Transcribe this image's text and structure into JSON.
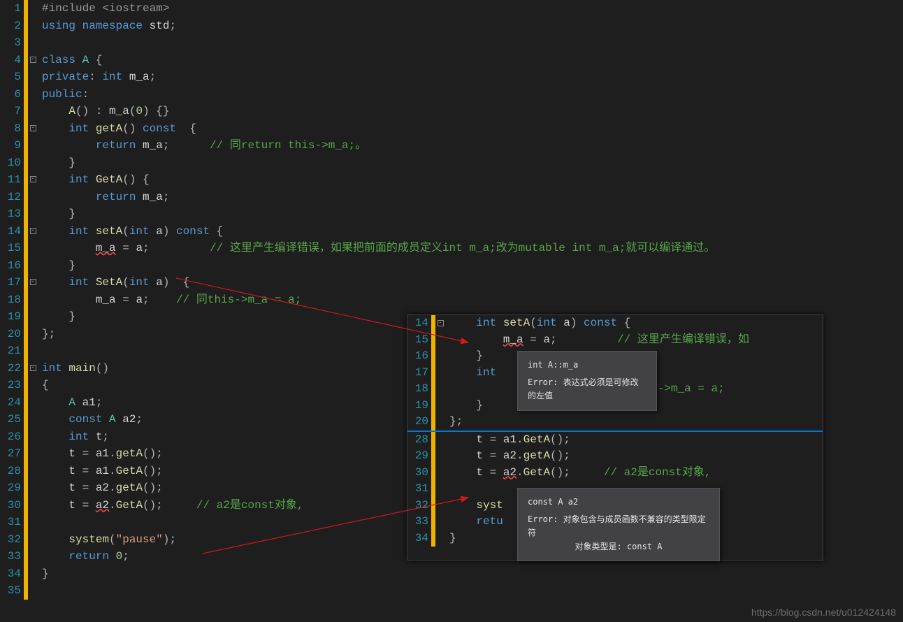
{
  "main": {
    "lines": [
      {
        "n": 1,
        "fold": "",
        "code": [
          {
            "c": "pp",
            "t": "#include <iostream>"
          }
        ]
      },
      {
        "n": 2,
        "fold": "",
        "code": [
          {
            "c": "kw",
            "t": "using namespace "
          },
          {
            "c": "id",
            "t": "std"
          },
          {
            "c": "op",
            "t": ";"
          }
        ]
      },
      {
        "n": 3,
        "fold": "",
        "code": []
      },
      {
        "n": 4,
        "fold": "-",
        "code": [
          {
            "c": "kw",
            "t": "class "
          },
          {
            "c": "ty",
            "t": "A"
          },
          {
            "c": "op",
            "t": " {"
          }
        ]
      },
      {
        "n": 5,
        "fold": "",
        "code": [
          {
            "c": "kw",
            "t": "private"
          },
          {
            "c": "op",
            "t": ": "
          },
          {
            "c": "kw",
            "t": "int "
          },
          {
            "c": "id",
            "t": "m_a"
          },
          {
            "c": "op",
            "t": ";"
          }
        ]
      },
      {
        "n": 6,
        "fold": "",
        "code": [
          {
            "c": "kw",
            "t": "public"
          },
          {
            "c": "op",
            "t": ":"
          }
        ]
      },
      {
        "n": 7,
        "fold": "",
        "code": [
          {
            "c": "op",
            "t": "    "
          },
          {
            "c": "fn",
            "t": "A"
          },
          {
            "c": "op",
            "t": "() : "
          },
          {
            "c": "id",
            "t": "m_a"
          },
          {
            "c": "op",
            "t": "("
          },
          {
            "c": "num",
            "t": "0"
          },
          {
            "c": "op",
            "t": ") {}"
          }
        ]
      },
      {
        "n": 8,
        "fold": "-",
        "code": [
          {
            "c": "op",
            "t": "    "
          },
          {
            "c": "kw",
            "t": "int "
          },
          {
            "c": "fn",
            "t": "getA"
          },
          {
            "c": "op",
            "t": "() "
          },
          {
            "c": "kw",
            "t": "const"
          },
          {
            "c": "op",
            "t": "  {"
          }
        ]
      },
      {
        "n": 9,
        "fold": "",
        "code": [
          {
            "c": "op",
            "t": "        "
          },
          {
            "c": "kw",
            "t": "return "
          },
          {
            "c": "id",
            "t": "m_a"
          },
          {
            "c": "op",
            "t": ";      "
          },
          {
            "c": "cm",
            "t": "// 同return this->m_a;。"
          }
        ]
      },
      {
        "n": 10,
        "fold": "",
        "code": [
          {
            "c": "op",
            "t": "    }"
          }
        ]
      },
      {
        "n": 11,
        "fold": "-",
        "code": [
          {
            "c": "op",
            "t": "    "
          },
          {
            "c": "kw",
            "t": "int "
          },
          {
            "c": "fn",
            "t": "GetA"
          },
          {
            "c": "op",
            "t": "() {"
          }
        ]
      },
      {
        "n": 12,
        "fold": "",
        "code": [
          {
            "c": "op",
            "t": "        "
          },
          {
            "c": "kw",
            "t": "return "
          },
          {
            "c": "id",
            "t": "m_a"
          },
          {
            "c": "op",
            "t": ";"
          }
        ]
      },
      {
        "n": 13,
        "fold": "",
        "code": [
          {
            "c": "op",
            "t": "    }"
          }
        ]
      },
      {
        "n": 14,
        "fold": "-",
        "code": [
          {
            "c": "op",
            "t": "    "
          },
          {
            "c": "kw",
            "t": "int "
          },
          {
            "c": "fn",
            "t": "setA"
          },
          {
            "c": "op",
            "t": "("
          },
          {
            "c": "kw",
            "t": "int "
          },
          {
            "c": "id",
            "t": "a"
          },
          {
            "c": "op",
            "t": ") "
          },
          {
            "c": "kw",
            "t": "const"
          },
          {
            "c": "op",
            "t": " {"
          }
        ]
      },
      {
        "n": 15,
        "fold": "",
        "code": [
          {
            "c": "op",
            "t": "        "
          },
          {
            "c": "id err-und",
            "t": "m_a"
          },
          {
            "c": "op",
            "t": " = "
          },
          {
            "c": "id",
            "t": "a"
          },
          {
            "c": "op",
            "t": ";         "
          },
          {
            "c": "cm",
            "t": "// 这里产生编译错误，如果把前面的成员定义int m_a;改为mutable int m_a;就可以编译通过。"
          }
        ]
      },
      {
        "n": 16,
        "fold": "",
        "code": [
          {
            "c": "op",
            "t": "    }"
          }
        ]
      },
      {
        "n": 17,
        "fold": "-",
        "code": [
          {
            "c": "op",
            "t": "    "
          },
          {
            "c": "kw",
            "t": "int "
          },
          {
            "c": "fn",
            "t": "SetA"
          },
          {
            "c": "op",
            "t": "("
          },
          {
            "c": "kw",
            "t": "int "
          },
          {
            "c": "id",
            "t": "a"
          },
          {
            "c": "op",
            "t": ")  {"
          }
        ]
      },
      {
        "n": 18,
        "fold": "",
        "code": [
          {
            "c": "op",
            "t": "        "
          },
          {
            "c": "id",
            "t": "m_a"
          },
          {
            "c": "op",
            "t": " = "
          },
          {
            "c": "id",
            "t": "a"
          },
          {
            "c": "op",
            "t": ";    "
          },
          {
            "c": "cm",
            "t": "// 同this->m_a = a;"
          }
        ]
      },
      {
        "n": 19,
        "fold": "",
        "code": [
          {
            "c": "op",
            "t": "    }"
          }
        ]
      },
      {
        "n": 20,
        "fold": "",
        "code": [
          {
            "c": "op",
            "t": "};"
          }
        ]
      },
      {
        "n": 21,
        "fold": "",
        "code": []
      },
      {
        "n": 22,
        "fold": "-",
        "code": [
          {
            "c": "kw",
            "t": "int "
          },
          {
            "c": "fn",
            "t": "main"
          },
          {
            "c": "op",
            "t": "()"
          }
        ]
      },
      {
        "n": 23,
        "fold": "",
        "code": [
          {
            "c": "op",
            "t": "{"
          }
        ]
      },
      {
        "n": 24,
        "fold": "",
        "code": [
          {
            "c": "op",
            "t": "    "
          },
          {
            "c": "ty",
            "t": "A"
          },
          {
            "c": "op",
            "t": " "
          },
          {
            "c": "id",
            "t": "a1"
          },
          {
            "c": "op",
            "t": ";"
          }
        ]
      },
      {
        "n": 25,
        "fold": "",
        "code": [
          {
            "c": "op",
            "t": "    "
          },
          {
            "c": "kw",
            "t": "const "
          },
          {
            "c": "ty",
            "t": "A"
          },
          {
            "c": "op",
            "t": " "
          },
          {
            "c": "id",
            "t": "a2"
          },
          {
            "c": "op",
            "t": ";"
          }
        ]
      },
      {
        "n": 26,
        "fold": "",
        "code": [
          {
            "c": "op",
            "t": "    "
          },
          {
            "c": "kw",
            "t": "int "
          },
          {
            "c": "id",
            "t": "t"
          },
          {
            "c": "op",
            "t": ";"
          }
        ]
      },
      {
        "n": 27,
        "fold": "",
        "code": [
          {
            "c": "op",
            "t": "    "
          },
          {
            "c": "id",
            "t": "t"
          },
          {
            "c": "op",
            "t": " = "
          },
          {
            "c": "id",
            "t": "a1"
          },
          {
            "c": "op",
            "t": "."
          },
          {
            "c": "fn",
            "t": "getA"
          },
          {
            "c": "op",
            "t": "();"
          }
        ]
      },
      {
        "n": 28,
        "fold": "",
        "code": [
          {
            "c": "op",
            "t": "    "
          },
          {
            "c": "id",
            "t": "t"
          },
          {
            "c": "op",
            "t": " = "
          },
          {
            "c": "id",
            "t": "a1"
          },
          {
            "c": "op",
            "t": "."
          },
          {
            "c": "fn",
            "t": "GetA"
          },
          {
            "c": "op",
            "t": "();"
          }
        ]
      },
      {
        "n": 29,
        "fold": "",
        "code": [
          {
            "c": "op",
            "t": "    "
          },
          {
            "c": "id",
            "t": "t"
          },
          {
            "c": "op",
            "t": " = "
          },
          {
            "c": "id",
            "t": "a2"
          },
          {
            "c": "op",
            "t": "."
          },
          {
            "c": "fn",
            "t": "getA"
          },
          {
            "c": "op",
            "t": "();"
          }
        ]
      },
      {
        "n": 30,
        "fold": "",
        "code": [
          {
            "c": "op",
            "t": "    "
          },
          {
            "c": "id",
            "t": "t"
          },
          {
            "c": "op",
            "t": " = "
          },
          {
            "c": "id err-und",
            "t": "a2"
          },
          {
            "c": "op",
            "t": "."
          },
          {
            "c": "fn",
            "t": "GetA"
          },
          {
            "c": "op",
            "t": "();     "
          },
          {
            "c": "cm",
            "t": "// a2是const对象,"
          }
        ]
      },
      {
        "n": 31,
        "fold": "",
        "code": []
      },
      {
        "n": 32,
        "fold": "",
        "code": [
          {
            "c": "op",
            "t": "    "
          },
          {
            "c": "fn",
            "t": "system"
          },
          {
            "c": "op",
            "t": "("
          },
          {
            "c": "str",
            "t": "\"pause\""
          },
          {
            "c": "op",
            "t": ");"
          }
        ]
      },
      {
        "n": 33,
        "fold": "",
        "code": [
          {
            "c": "op",
            "t": "    "
          },
          {
            "c": "kw",
            "t": "return "
          },
          {
            "c": "num",
            "t": "0"
          },
          {
            "c": "op",
            "t": ";"
          }
        ]
      },
      {
        "n": 34,
        "fold": "",
        "code": [
          {
            "c": "op",
            "t": "}"
          }
        ]
      },
      {
        "n": 35,
        "fold": "",
        "code": []
      }
    ]
  },
  "inset": {
    "top": [
      {
        "n": 14,
        "fold": "-",
        "code": [
          {
            "c": "op",
            "t": "    "
          },
          {
            "c": "kw",
            "t": "int "
          },
          {
            "c": "fn",
            "t": "setA"
          },
          {
            "c": "op",
            "t": "("
          },
          {
            "c": "kw",
            "t": "int "
          },
          {
            "c": "id",
            "t": "a"
          },
          {
            "c": "op",
            "t": ") "
          },
          {
            "c": "kw",
            "t": "const"
          },
          {
            "c": "op",
            "t": " {"
          }
        ]
      },
      {
        "n": 15,
        "fold": "",
        "code": [
          {
            "c": "op",
            "t": "        "
          },
          {
            "c": "id err-und",
            "t": "m_a"
          },
          {
            "c": "op",
            "t": " = "
          },
          {
            "c": "id",
            "t": "a"
          },
          {
            "c": "op",
            "t": ";         "
          },
          {
            "c": "cm",
            "t": "// 这里产生编译错误，如"
          }
        ]
      },
      {
        "n": 16,
        "fold": "",
        "code": [
          {
            "c": "op",
            "t": "    }"
          }
        ]
      },
      {
        "n": 17,
        "fold": "",
        "code": [
          {
            "c": "op",
            "t": "    "
          },
          {
            "c": "kw",
            "t": "int"
          }
        ]
      },
      {
        "n": 18,
        "fold": "",
        "code": [
          {
            "c": "op",
            "t": "                           "
          },
          {
            "c": "cm",
            "t": "this->m_a = a;"
          }
        ]
      },
      {
        "n": 19,
        "fold": "",
        "code": [
          {
            "c": "op",
            "t": "    }"
          }
        ]
      },
      {
        "n": 20,
        "fold": "",
        "code": [
          {
            "c": "op",
            "t": "};"
          }
        ]
      }
    ],
    "bottom": [
      {
        "n": 28,
        "fold": "",
        "code": [
          {
            "c": "op",
            "t": "    "
          },
          {
            "c": "id",
            "t": "t"
          },
          {
            "c": "op",
            "t": " = "
          },
          {
            "c": "id",
            "t": "a1"
          },
          {
            "c": "op",
            "t": "."
          },
          {
            "c": "fn",
            "t": "GetA"
          },
          {
            "c": "op",
            "t": "();"
          }
        ]
      },
      {
        "n": 29,
        "fold": "",
        "code": [
          {
            "c": "op",
            "t": "    "
          },
          {
            "c": "id",
            "t": "t"
          },
          {
            "c": "op",
            "t": " = "
          },
          {
            "c": "id",
            "t": "a2"
          },
          {
            "c": "op",
            "t": "."
          },
          {
            "c": "fn",
            "t": "getA"
          },
          {
            "c": "op",
            "t": "();"
          }
        ]
      },
      {
        "n": 30,
        "fold": "",
        "code": [
          {
            "c": "op",
            "t": "    "
          },
          {
            "c": "id",
            "t": "t"
          },
          {
            "c": "op",
            "t": " = "
          },
          {
            "c": "id err-und",
            "t": "a2"
          },
          {
            "c": "op",
            "t": "."
          },
          {
            "c": "fn",
            "t": "GetA"
          },
          {
            "c": "op",
            "t": "();     "
          },
          {
            "c": "cm",
            "t": "// a2是const对象,"
          }
        ]
      },
      {
        "n": 31,
        "fold": "",
        "code": []
      },
      {
        "n": 32,
        "fold": "",
        "code": [
          {
            "c": "op",
            "t": "    "
          },
          {
            "c": "fn",
            "t": "syst"
          }
        ]
      },
      {
        "n": 33,
        "fold": "",
        "code": [
          {
            "c": "op",
            "t": "    "
          },
          {
            "c": "kw",
            "t": "retu"
          }
        ]
      },
      {
        "n": 34,
        "fold": "",
        "code": [
          {
            "c": "op",
            "t": "}"
          }
        ]
      }
    ]
  },
  "tooltip1": {
    "sig": "int A::m_a",
    "err": "Error: 表达式必须是可修改的左值"
  },
  "tooltip2": {
    "sig": "const A a2",
    "err1": "Error: 对象包含与成员函数不兼容的类型限定符",
    "err2": "对象类型是:  const A"
  },
  "watermark": "https://blog.csdn.net/u012424148"
}
